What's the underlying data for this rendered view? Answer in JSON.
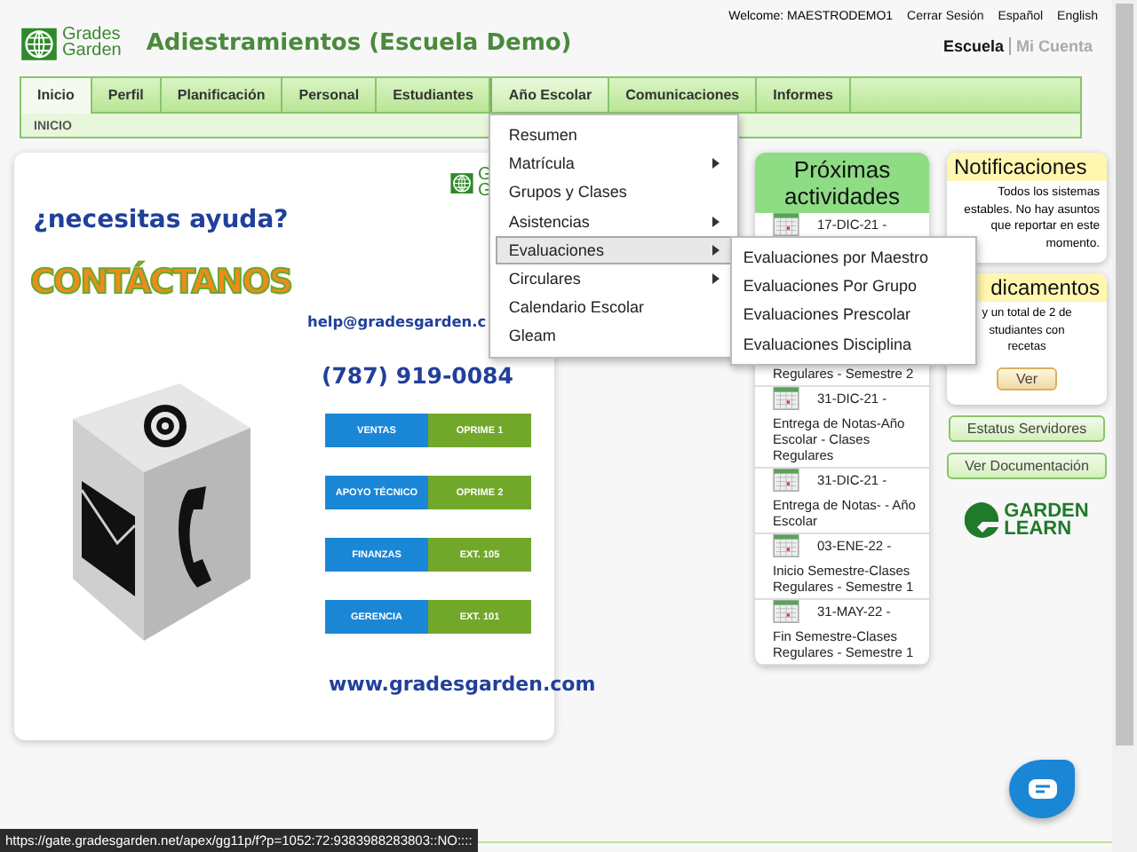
{
  "header": {
    "title": "Adiestramientos (Escuela Demo)",
    "logo_line_1": "Grades",
    "logo_line_2": "Garden",
    "welcome": "Welcome: MAESTRODEMO1",
    "links": [
      "Cerrar Sesión",
      "Español",
      "English"
    ],
    "account_links": [
      {
        "label": "Escuela",
        "selected": true
      },
      {
        "label": "Mi Cuenta",
        "selected": false
      }
    ]
  },
  "tabs": [
    {
      "label": "Inicio",
      "selected": true,
      "expanded": false
    },
    {
      "label": "Perfil",
      "selected": false,
      "expanded": false
    },
    {
      "label": "Planificación",
      "selected": false,
      "expanded": false
    },
    {
      "label": "Personal",
      "selected": false,
      "expanded": false
    },
    {
      "label": "Estudiantes",
      "selected": false,
      "expanded": false
    },
    {
      "label": "Año Escolar",
      "selected": false,
      "expanded": true
    },
    {
      "label": "Comunicaciones",
      "selected": false,
      "expanded": false
    },
    {
      "label": "Informes",
      "selected": false,
      "expanded": false
    }
  ],
  "breadcrumb": "INICIO",
  "menu": [
    {
      "label": "Resumen",
      "submenu": false,
      "selected": false
    },
    {
      "label": "Matrícula",
      "submenu": true,
      "selected": false
    },
    {
      "label": "Grupos y Clases",
      "submenu": false,
      "selected": false
    },
    {
      "label": "Asistencias",
      "submenu": true,
      "selected": false
    },
    {
      "label": "Evaluaciones",
      "submenu": true,
      "selected": true
    },
    {
      "label": "Circulares",
      "submenu": true,
      "selected": false
    },
    {
      "label": "Calendario Escolar",
      "submenu": false,
      "selected": false
    },
    {
      "label": "Gleam",
      "submenu": false,
      "selected": false
    }
  ],
  "submenu": [
    "Evaluaciones por Maestro",
    "Evaluaciones Por Grupo",
    "Evaluaciones Prescolar",
    "Evaluaciones Disciplina"
  ],
  "banner": {
    "question": "¿necesitas ayuda?",
    "headline": "CONTÁCTANOS",
    "logo_line_1": "G",
    "logo_line_2": "G",
    "email": "help@gradesgarden.c",
    "phone": "(787) 919-0084",
    "contacts": [
      {
        "department": "VENTAS",
        "action": "OPRIME 1"
      },
      {
        "department": "APOYO TÉCNICO",
        "action": "OPRIME 2"
      },
      {
        "department": "FINANZAS",
        "action": "EXT. 105"
      },
      {
        "department": "GERENCIA",
        "action": "EXT. 101"
      }
    ],
    "website": "www.gradesgarden.com"
  },
  "activities": {
    "title": "Próximas actividades",
    "items": [
      {
        "date": "17-DIC-21 -",
        "description": "Regulares - Semestre 2"
      },
      {
        "date": "31-DIC-21 -",
        "description": "Entrega de Notas-Año Escolar - Clases Regulares"
      },
      {
        "date": "31-DIC-21 -",
        "description": "Entrega de Notas- - Año Escolar"
      },
      {
        "date": "03-ENE-22 -",
        "description": "Inicio Semestre-Clases Regulares - Semestre 1"
      },
      {
        "date": "31-MAY-22 -",
        "description": "Fin Semestre-Clases Regulares - Semestre 1"
      }
    ]
  },
  "notifications": {
    "title": "Notificaciones",
    "message": "Todos los sistemas estables. No hay asuntos que reportar en este momento."
  },
  "medications": {
    "title": "dicamentos",
    "lines": [
      "y un total de 2 de",
      "studiantes con",
      "recetas"
    ],
    "button": "Ver"
  },
  "side_buttons": [
    "Estatus Servidores",
    "Ver Documentación"
  ],
  "garden_learn": {
    "line_1": "GARDEN",
    "line_2": "LEARN"
  },
  "status_bar": "https://gate.gradesgarden.net/apex/gg11p/f?p=1052:72:9383988283803::NO::::"
}
